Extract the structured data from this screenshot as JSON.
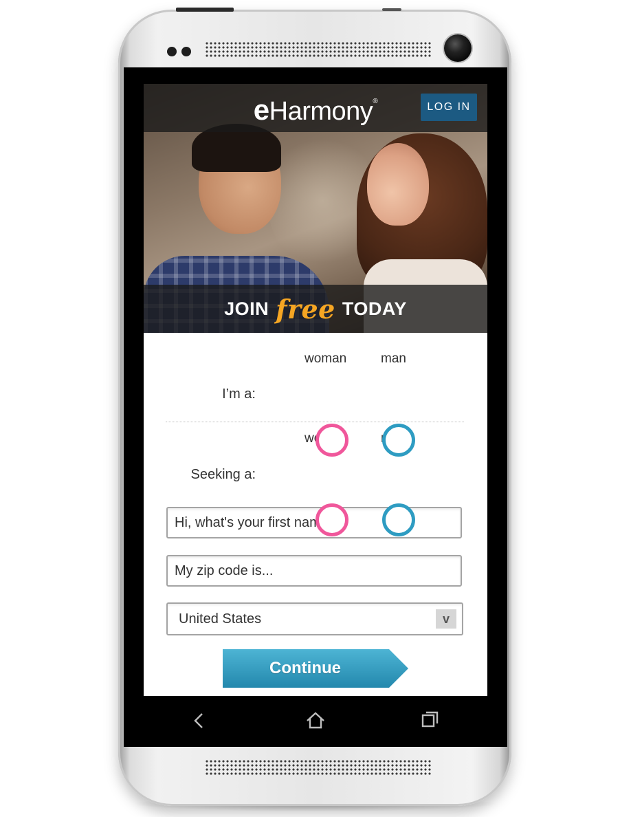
{
  "app": {
    "logo_prefix": "e",
    "logo_text": "Harmony",
    "logo_mark": "®",
    "login_label": "LOG IN"
  },
  "hero": {
    "join_prefix": "JOIN",
    "join_highlight": "free",
    "join_suffix": "TODAY"
  },
  "form": {
    "im_a": {
      "label": "I’m a:",
      "options": [
        "woman",
        "man"
      ]
    },
    "seeking_a": {
      "label": "Seeking a:",
      "options": [
        "woman",
        "man"
      ]
    },
    "first_name_placeholder": "Hi, what's your first name?",
    "zip_placeholder": "My zip code is...",
    "country_value": "United States",
    "country_arrow": "v",
    "continue_label": "Continue"
  },
  "colors": {
    "woman_radio": "#f0579b",
    "man_radio": "#2e9cc2",
    "login_button": "#1c5a82",
    "continue_button": "#2e9cc2",
    "free_text": "#f6a623"
  },
  "nav": {
    "icons": [
      "back-icon",
      "home-icon",
      "recent-apps-icon"
    ]
  }
}
